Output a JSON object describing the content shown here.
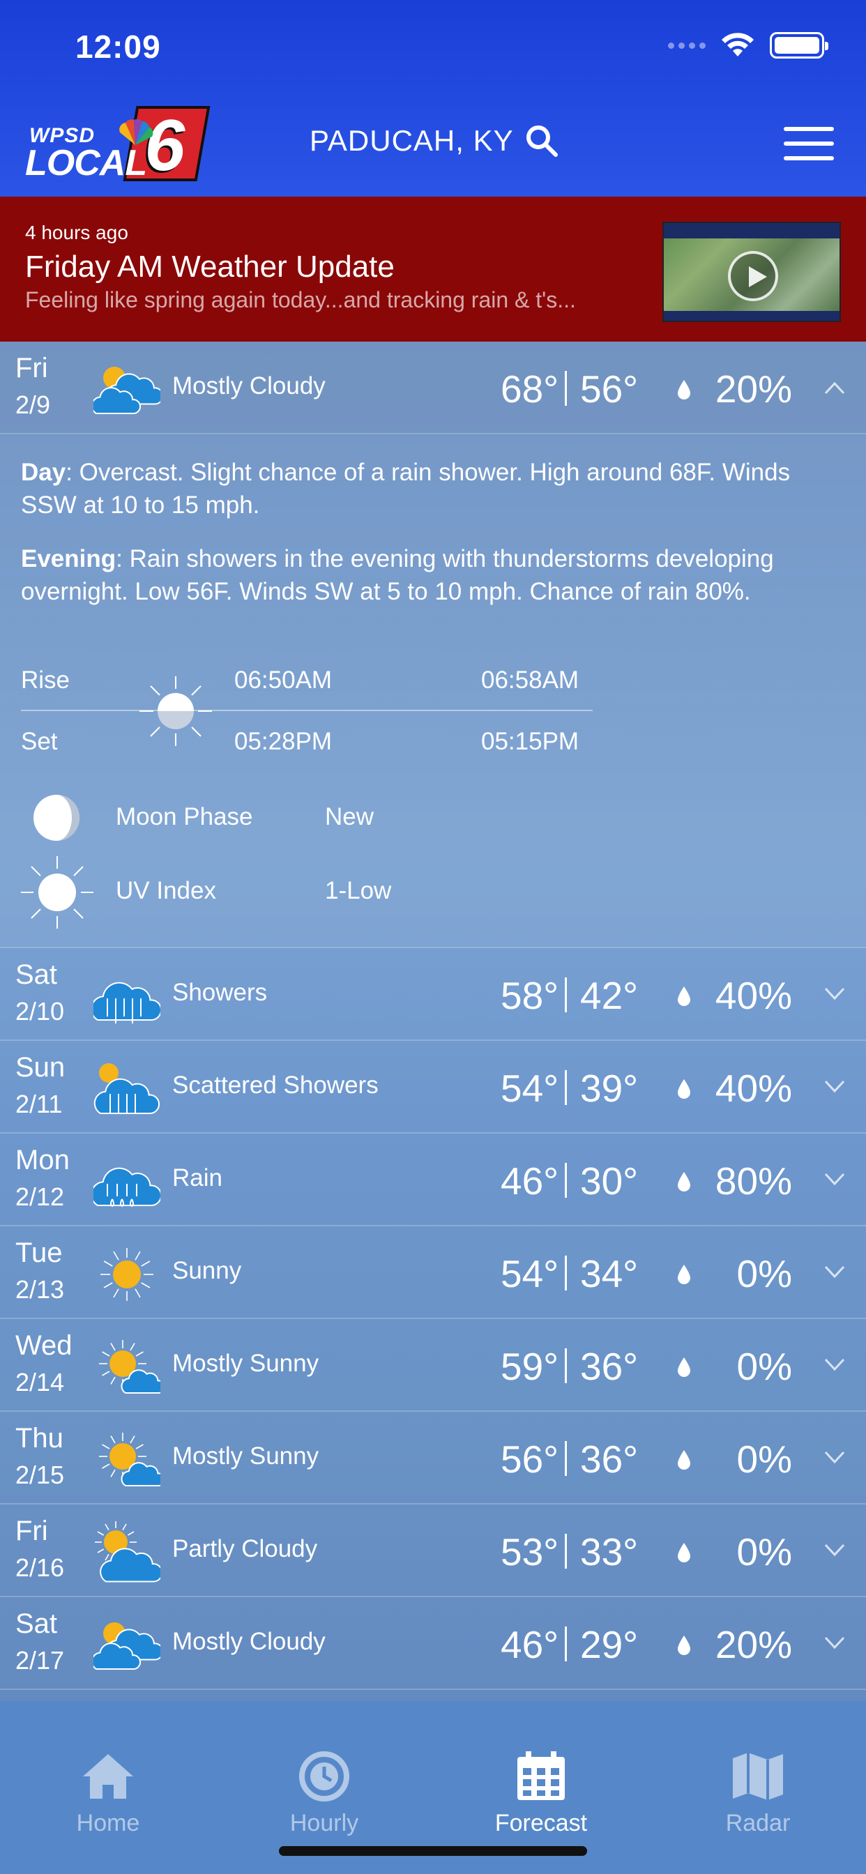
{
  "status": {
    "time": "12:09"
  },
  "header": {
    "logo_top": "WPSD",
    "logo_bottom": "LOCAL",
    "logo_number": "6",
    "location": "PADUCAH, KY"
  },
  "news": {
    "time_ago": "4 hours ago",
    "title": "Friday AM Weather Update",
    "subtitle": "Feeling like spring again today...and tracking rain & t's..."
  },
  "forecast": [
    {
      "day": "Fri",
      "date": "2/9",
      "icon": "mostly-cloudy-icon",
      "condition": "Mostly Cloudy",
      "hi": "68°",
      "lo": "56°",
      "pop": "20%",
      "expanded": true
    },
    {
      "day": "Sat",
      "date": "2/10",
      "icon": "showers-icon",
      "condition": "Showers",
      "hi": "58°",
      "lo": "42°",
      "pop": "40%"
    },
    {
      "day": "Sun",
      "date": "2/11",
      "icon": "scattered-showers-icon",
      "condition": "Scattered Showers",
      "hi": "54°",
      "lo": "39°",
      "pop": "40%"
    },
    {
      "day": "Mon",
      "date": "2/12",
      "icon": "rain-icon",
      "condition": "Rain",
      "hi": "46°",
      "lo": "30°",
      "pop": "80%"
    },
    {
      "day": "Tue",
      "date": "2/13",
      "icon": "sunny-icon",
      "condition": "Sunny",
      "hi": "54°",
      "lo": "34°",
      "pop": "0%"
    },
    {
      "day": "Wed",
      "date": "2/14",
      "icon": "mostly-sunny-icon",
      "condition": "Mostly Sunny",
      "hi": "59°",
      "lo": "36°",
      "pop": "0%"
    },
    {
      "day": "Thu",
      "date": "2/15",
      "icon": "mostly-sunny-icon",
      "condition": "Mostly Sunny",
      "hi": "56°",
      "lo": "36°",
      "pop": "0%"
    },
    {
      "day": "Fri",
      "date": "2/16",
      "icon": "partly-cloudy-icon",
      "condition": "Partly Cloudy",
      "hi": "53°",
      "lo": "33°",
      "pop": "0%"
    },
    {
      "day": "Sat",
      "date": "2/17",
      "icon": "mostly-cloudy-icon",
      "condition": "Mostly Cloudy",
      "hi": "46°",
      "lo": "29°",
      "pop": "20%"
    }
  ],
  "details": {
    "day_label": "Day",
    "day_text": ": Overcast. Slight chance of a rain shower. High around 68F. Winds SSW at 10 to 15 mph.",
    "evening_label": "Evening",
    "evening_text": ": Rain showers in the evening with thunderstorms developing overnight. Low 56F. Winds SW at 5 to 10 mph. Chance of rain 80%.",
    "rise_label": "Rise",
    "set_label": "Set",
    "sunrise": "06:50AM",
    "sunset": "05:28PM",
    "moonrise": "06:58AM",
    "moonset": "05:15PM",
    "moon_phase_label": "Moon Phase",
    "moon_phase_value": "New",
    "uv_label": "UV Index",
    "uv_value": "1-Low"
  },
  "tabs": [
    {
      "label": "Home",
      "icon": "home-icon",
      "active": false
    },
    {
      "label": "Hourly",
      "icon": "clock-icon",
      "active": false
    },
    {
      "label": "Forecast",
      "icon": "calendar-icon",
      "active": true
    },
    {
      "label": "Radar",
      "icon": "map-icon",
      "active": false
    }
  ],
  "colors": {
    "header_blue": "#2b55e6",
    "news_red": "#8a0708",
    "sun_yellow": "#f4b41a",
    "cloud_blue": "#1e88d6",
    "tabbar": "#5688c9"
  }
}
